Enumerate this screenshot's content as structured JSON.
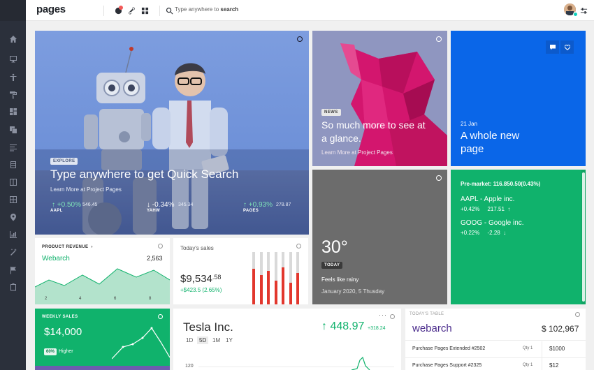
{
  "header": {
    "logo": "pages",
    "search_prefix": "Type anywhere to ",
    "search_bold": "search"
  },
  "sidebar": {
    "icons": [
      "home-icon",
      "desktop-icon",
      "accessibility-icon",
      "paint-roller-icon",
      "layouts-icon",
      "layers-icon",
      "align-left-icon",
      "database-icon",
      "columns-icon",
      "table-icon",
      "map-pin-icon",
      "chart-icon",
      "magic-icon",
      "flag-icon",
      "clipboard-icon"
    ]
  },
  "hero": {
    "tag": "EXPLORE",
    "title": "Type anywhere to get Quick Search",
    "subtitle": "Learn More at Project Pages",
    "stocks": [
      {
        "name": "AAPL",
        "change": "+0.50%",
        "price": "546.45"
      },
      {
        "name": "YAHW",
        "change": "-0.34%",
        "price": "345.34"
      },
      {
        "name": "PAGES",
        "change": "+0.93%",
        "price": "278.87"
      }
    ]
  },
  "news": {
    "tag": "NEWS",
    "title_line1": "So much more to see at",
    "title_line2": "a glance.",
    "subtitle": "Learn More at Project Pages"
  },
  "blue_card": {
    "date": "21 Jan",
    "title_line1": "A whole new",
    "title_line2": "page"
  },
  "weather": {
    "temp": "30°",
    "tag": "TODAY",
    "desc": "Feels like rainy",
    "date": "January 2020, 5 Thusday"
  },
  "market": {
    "premarket": "Pre-market: 116.850.50(0.43%)",
    "items": [
      {
        "name": "AAPL - Apple inc.",
        "change": "+0.42%",
        "value": "217.51"
      },
      {
        "name": "GOOG - Google inc.",
        "change": "+0.22%",
        "value": "-2.28"
      }
    ]
  },
  "product_revenue": {
    "label": "PRODUCT REVENUE",
    "name": "Webarch",
    "value": "2,563",
    "ticks": [
      "2",
      "4",
      "6",
      "8"
    ]
  },
  "todays_sales": {
    "label": "Today's sales",
    "value_main": "$9,534",
    "value_cents": ".58",
    "change": "+$423.5 (2.65%)",
    "bars": [
      0.9,
      0.75,
      0.85,
      0.6,
      0.95,
      0.55,
      0.8
    ]
  },
  "weekly_sales": {
    "label": "WEEKLY SALES",
    "value": "$14,000",
    "badge": "60%",
    "badge_text": "Higher"
  },
  "tesla": {
    "name": "Tesla Inc.",
    "price": "448.97",
    "change": "+318.24",
    "ranges": [
      "1D",
      "5D",
      "1M",
      "1Y"
    ],
    "active_range": "5D",
    "axis_value": "120"
  },
  "todays_table": {
    "label": "TODAY'S TABLE",
    "title": "webarch",
    "total": "$ 102,967",
    "rows": [
      {
        "item": "Purchase Pages Extended #2502",
        "qty": "Qty 1",
        "price": "$1000"
      },
      {
        "item": "Purchase Pages Support #2325",
        "qty": "Qty 1",
        "price": "$12"
      }
    ]
  },
  "colors": {
    "sidebar": "#2b303b",
    "green": "#10b26c",
    "blue": "#0a66e8",
    "red": "#f35958",
    "purple": "#4b2c8c",
    "magenta": "#d3166e"
  }
}
